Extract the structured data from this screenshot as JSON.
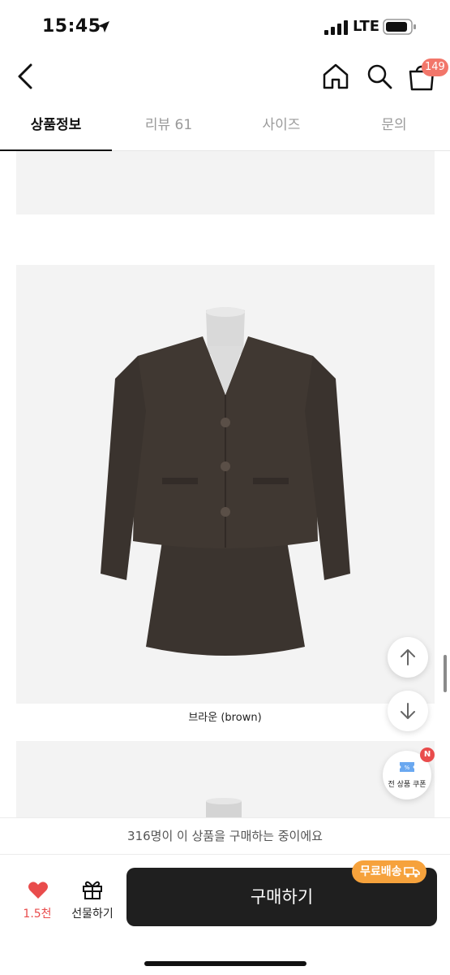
{
  "status": {
    "time": "15:45",
    "network": "LTE"
  },
  "nav": {
    "cart_count": "149"
  },
  "tabs": [
    {
      "label": "상품정보",
      "active": true
    },
    {
      "label": "리뷰 61",
      "active": false
    },
    {
      "label": "사이즈",
      "active": false
    },
    {
      "label": "문의",
      "active": false
    }
  ],
  "content": {
    "color_caption": "브라운 (brown)"
  },
  "coupon": {
    "label": "전 상품 쿠폰",
    "new_badge": "N"
  },
  "notice": {
    "text": "316명이 이 상품을 구매하는 중이에요"
  },
  "actions": {
    "like_count": "1.5천",
    "gift_label": "선물하기",
    "buy_label": "구매하기",
    "shipping_badge": "무료배송"
  },
  "colors": {
    "accent": "#e94c4c",
    "badge_orange": "#f6a23c",
    "buy_button": "#1f1f1f",
    "cart_badge": "#f2766a"
  }
}
